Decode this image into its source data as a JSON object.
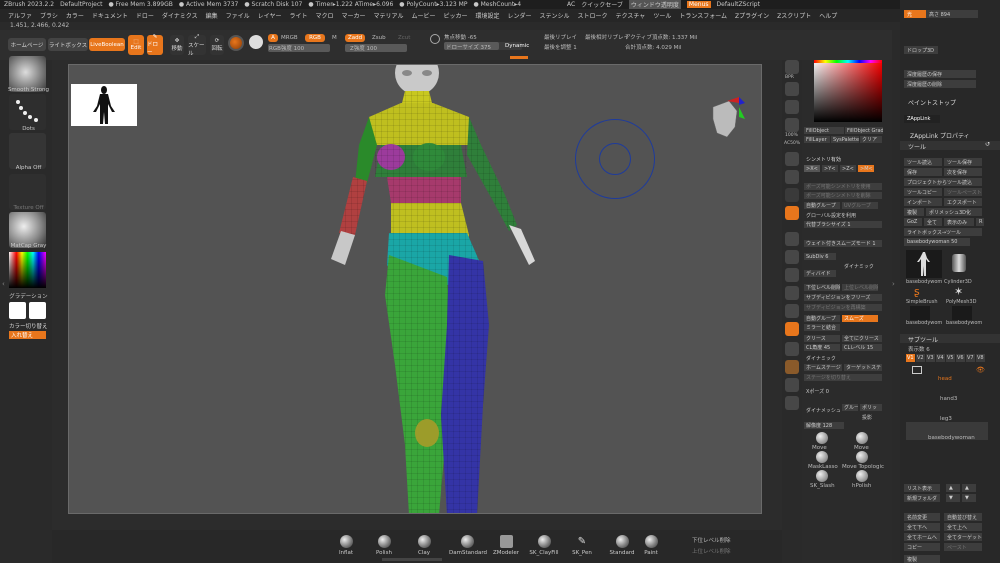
{
  "titlebar": {
    "items": [
      "ZBrush 2023.2.2",
      "DefaultProject",
      "● Free Mem 3.899GB",
      "● Active Mem 3737",
      "● Scratch Disk 107",
      "● Timer▸1.222 ATime▸6.096",
      "● PolyCount▸3.123 MP",
      "● MeshCount▸4"
    ],
    "right": [
      "AC",
      "クイックセーブ",
      "ウィンドウ透明度",
      "Menus",
      "DefaultZScript"
    ]
  },
  "menubar": [
    "アルファ",
    "ブラシ",
    "カラー",
    "ドキュメント",
    "ドロー",
    "ダイナミクス",
    "編集",
    "ファイル",
    "レイヤー",
    "ライト",
    "マクロ",
    "マーカー",
    "マテリアル",
    "ムービー",
    "ピッカー",
    "環境設定",
    "レンダー",
    "ステンシル",
    "ストローク",
    "テクスチャ",
    "ツール",
    "トランスフォーム",
    "Zプラグイン",
    "Zスクリプト",
    "ヘルプ"
  ],
  "coord": "1.451, 2.466, 0.242",
  "topshelf": {
    "home": "ホームページ",
    "lightbox": "ライトボックス",
    "liveboolean": "LiveBoolean",
    "edit": "Edit",
    "draw": "ドロー",
    "move": "移動",
    "scale": "スケール",
    "rotate": "回転",
    "a": "A",
    "mrgb": "MRGB",
    "rgb": "RGB",
    "m": "M",
    "zadd": "Zadd",
    "zsub": "Zsub",
    "zcut": "Zcut",
    "rgb_intensity": "RGB強度 100",
    "z_intensity": "Z強度 100",
    "focal": "焦点移動 -65",
    "draw_size": "ドローサイズ 375",
    "dynamic": "Dynamic",
    "last_replay": "最後リプレイ",
    "replay_last_rel": "最後相対リプレイ",
    "adjust_last": "最後を調整 1",
    "active_points": "アクティブ頂点数: 1.337 Mil",
    "total_points": "合計頂点数: 4.029 Mil"
  },
  "leftshelf": {
    "brush": "Smooth Strong",
    "stroke": "Dots",
    "alpha": "Alpha Off",
    "texture": "Texture Off",
    "material": "MatCap Gray",
    "gradient": "グラデーション",
    "switch_color": "カラー切り替え",
    "swap": "入れ替え"
  },
  "rightshelf": [
    "BPR",
    "SPix 3",
    "スクロール",
    "ズーム",
    "100%",
    "AC50%",
    "パース",
    "床",
    "ローカル",
    "Gizmo",
    "Xyz",
    "フレーム",
    "移動",
    "スケール",
    "回転",
    "ポリF",
    "透明",
    "ゴースト",
    "ソロ",
    "Xpose"
  ],
  "palette": {
    "fill_object": "FillObject",
    "fill_object_grad": "FillObject Grad",
    "fill_layer": "FillLayer",
    "syspalette": "SysPalette",
    "clear": "クリア",
    "symmetry": "シンメトリ有効",
    "x": ">X<",
    "y": ">Y<",
    "z": ">Z<",
    "m": ">M<",
    "pose_sym": "ポーズ可能シンメトリを使用",
    "pose_sym_del": "ポーズ可能シンメトリを削除",
    "autogroup": "自動グループ",
    "uv_group": "UVグループ",
    "global_polish": "グローバル設定を利用",
    "replace_brush": "代替ブラシサイズ 1",
    "weld_sym": "ウェイト付きスムーズモード 1",
    "subdiv": "SubDiv 6",
    "dynamic": "ダイナミック",
    "divide": "ディバイド",
    "lower": "下位レベル削除",
    "higher": "上位レベル削除",
    "freeze": "サブディビジョンをフリーズ",
    "unfreeze": "サブディビジョンを再構築",
    "autogroup2": "自動グループ",
    "smooth": "スムーズ",
    "mirror_weld": "ミラーと結合",
    "crease": "クリース",
    "crease_all": "全てにクリース",
    "crease_level": "CLレベル 15",
    "crease_angle": "CL角度 45",
    "dynamic2": "ダイナミック",
    "homestage": "ホームステージ",
    "target": "ターゲットステ",
    "stage_switch": "ステージを切り替え",
    "xpose": "Xポーズ 0",
    "dynamesh": "ダイナメッシュ",
    "group": "グルー",
    "polish": "ポリッ",
    "projection": "投影",
    "resolution": "解像度 128",
    "brushes": [
      "Move",
      "Move",
      "MaskLasso",
      "Move Topologic",
      "SK_Slash",
      "hPolish"
    ]
  },
  "tray": {
    "light": "光",
    "scale_value": "高さ 894",
    "drop3d": "ドロップ3D",
    "save_depth": "深度履歴の保存",
    "delete_depth": "深度履歴の削除",
    "paint_stop": "ペイントストップ",
    "zapplink": "ZAppLink",
    "zapplink_prop": "ZAppLink プロパティ",
    "tool": "ツール",
    "load_tool": "ツール読込",
    "save_as": "ツール保存",
    "save": "保存",
    "next": "次を保存",
    "load_project": "プロジェクトからツール読込",
    "copy_tool": "ツールコピー",
    "paste_tool": "ツールペースト",
    "import": "インポート",
    "export": "エクスポート",
    "clone": "複製",
    "make_polymesh": "ポリメッシュ3D化",
    "goz": "GoZ",
    "all": "全て",
    "visible": "表示のみ",
    "r": "R",
    "lightbox_tools": "ライトボックス→ツール",
    "basebody": "basebodywoman 50",
    "tools": [
      "basebodywom",
      "Cylinder3D",
      "SimpleBrush",
      "PolyMesh3D",
      "basebodywom",
      "basebodywom"
    ],
    "subtool": "サブツール",
    "visible_count": "表示数 6",
    "v_tabs": [
      "V1",
      "V2",
      "V3",
      "V4",
      "V5",
      "V6",
      "V7",
      "V8"
    ],
    "subtools": [
      "head",
      "hand3",
      "leg3",
      "basebodywoman"
    ],
    "list_all": "リスト表示",
    "new_folder": "新規フォルダ",
    "rename": "名前変更",
    "auto_reorder": "自動並び替え",
    "all_low": "全て下へ",
    "all_high": "全て上へ",
    "all_home": "全てホームへ",
    "all_target": "全てターゲット",
    "copy": "コピー",
    "paste": "ペースト",
    "duplicate": "複製"
  },
  "bottomshelf": {
    "brushes": [
      "Inflat",
      "Polish",
      "Clay",
      "DamStandard",
      "ZModeler",
      "SK_ClayFill",
      "SK_Pen",
      "Standard",
      "Paint"
    ],
    "lower_delete": "下位レベル削除",
    "higher_delete": "上位レベル削除"
  },
  "colors": {
    "accent": "#e8761c",
    "bg": "#2a2a2a",
    "canvas": "#535353"
  }
}
